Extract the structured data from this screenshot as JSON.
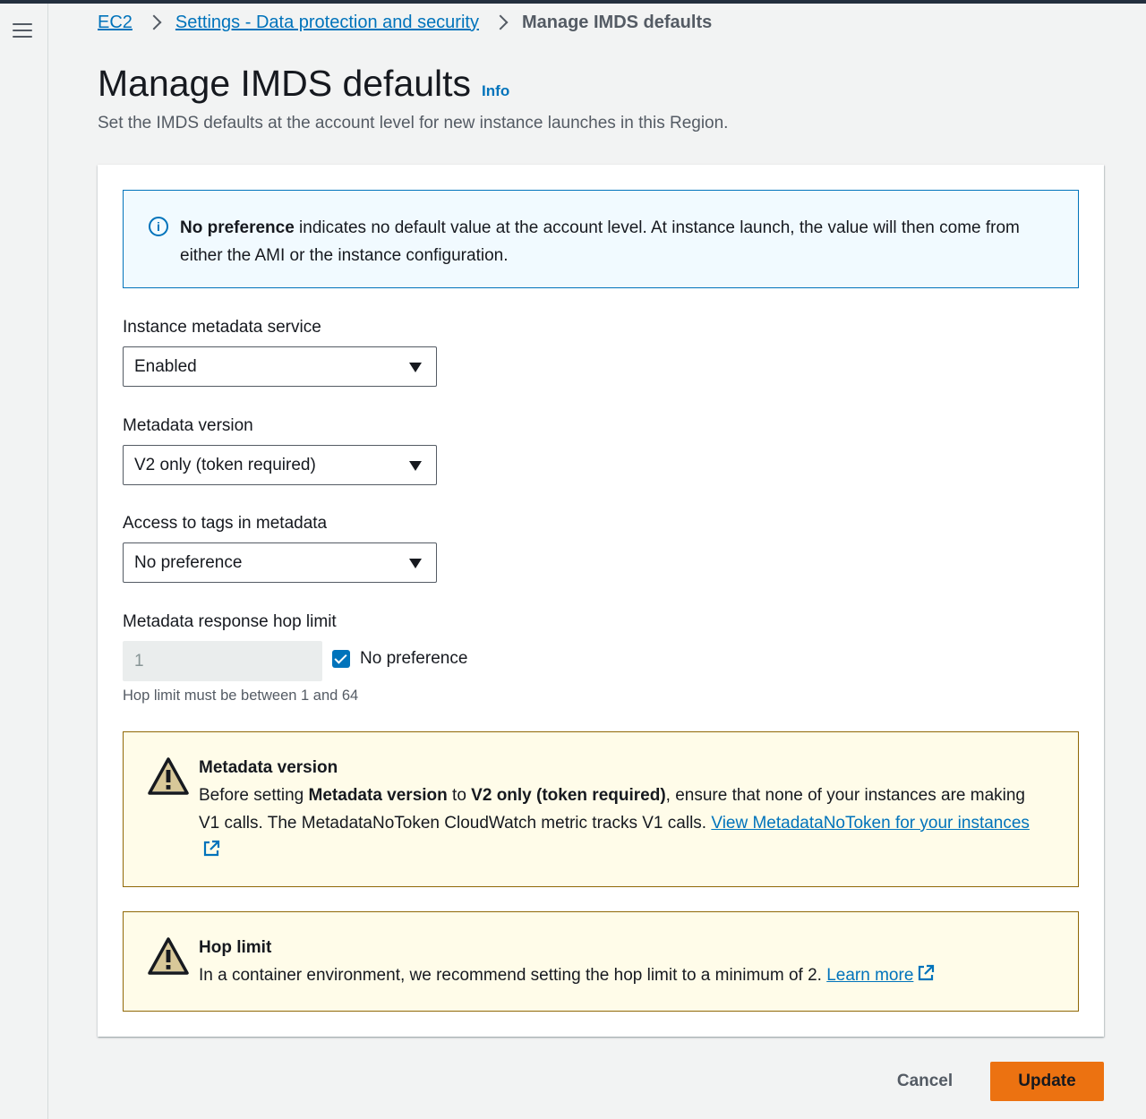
{
  "breadcrumb": {
    "items": [
      "EC2",
      "Settings - Data protection and security"
    ],
    "current": "Manage IMDS defaults"
  },
  "header": {
    "title": "Manage IMDS defaults",
    "info_link": "Info",
    "description": "Set the IMDS defaults at the account level for new instance launches in this Region."
  },
  "info_alert": {
    "bold_lead": "No preference",
    "text": " indicates no default value at the account level. At instance launch, the value will then come from either the AMI or the instance configuration."
  },
  "fields": {
    "imds": {
      "label": "Instance metadata service",
      "value": "Enabled"
    },
    "version": {
      "label": "Metadata version",
      "value": "V2 only (token required)"
    },
    "tags": {
      "label": "Access to tags in metadata",
      "value": "No preference"
    },
    "hop": {
      "label": "Metadata response hop limit",
      "value": "1",
      "checkbox_label": "No preference",
      "checked": true,
      "hint": "Hop limit must be between 1 and 64"
    }
  },
  "warning_version": {
    "title": "Metadata version",
    "t1": "Before setting ",
    "b1": "Metadata version",
    "t2": " to ",
    "b2": "V2 only (token required)",
    "t3": ", ensure that none of your instances are making V1 calls. The MetadataNoToken CloudWatch metric tracks V1 calls. ",
    "link": "View MetadataNoToken for your instances"
  },
  "warning_hop": {
    "title": "Hop limit",
    "text": "In a container environment, we recommend setting the hop limit to a minimum of 2. ",
    "link": "Learn more"
  },
  "actions": {
    "cancel": "Cancel",
    "update": "Update"
  },
  "colors": {
    "link": "#0073bb",
    "primary_button": "#ec7211",
    "warning_bg": "#fffce9",
    "warning_border": "#906806",
    "info_bg": "#f1faff"
  }
}
